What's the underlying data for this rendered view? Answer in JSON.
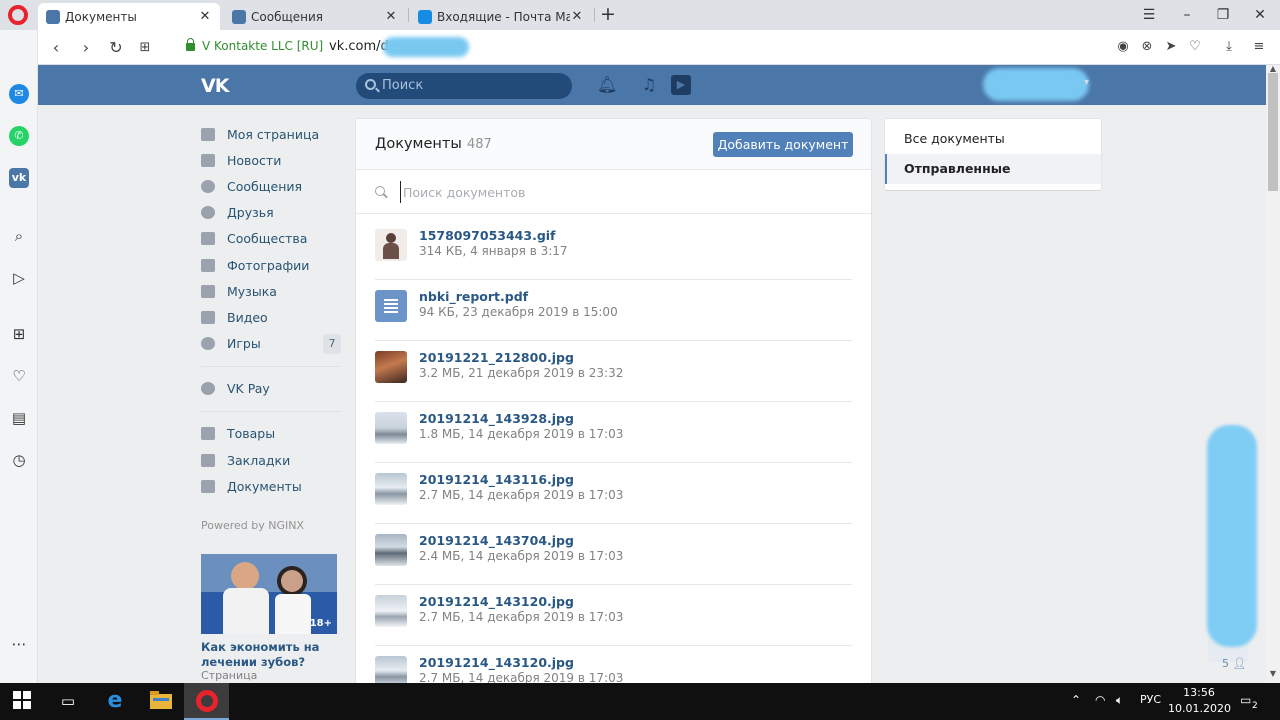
{
  "browser": {
    "tabs": [
      {
        "title": "Документы",
        "active": true
      },
      {
        "title": "Сообщения",
        "active": false
      },
      {
        "title": "Входящие - Почта Mail.ru",
        "active": false
      }
    ],
    "address": {
      "security_label": "V Kontakte LLC [RU]",
      "url": "vk.com/do"
    }
  },
  "vk": {
    "logo": "VK",
    "search_placeholder": "Поиск",
    "nav": [
      {
        "label": "Моя страница",
        "icon": "home-icon"
      },
      {
        "label": "Новости",
        "icon": "news-icon"
      },
      {
        "label": "Сообщения",
        "icon": "messages-icon"
      },
      {
        "label": "Друзья",
        "icon": "friends-icon"
      },
      {
        "label": "Сообщества",
        "icon": "groups-icon"
      },
      {
        "label": "Фотографии",
        "icon": "camera-icon"
      },
      {
        "label": "Музыка",
        "icon": "music-icon"
      },
      {
        "label": "Видео",
        "icon": "video-icon"
      },
      {
        "label": "Игры",
        "icon": "gamepad-icon",
        "badge": "7"
      }
    ],
    "nav_pay": {
      "label": "VK Pay",
      "icon": "vkpay-icon"
    },
    "nav_more": [
      {
        "label": "Товары",
        "icon": "bag-icon"
      },
      {
        "label": "Закладки",
        "icon": "star-icon"
      },
      {
        "label": "Документы",
        "icon": "document-icon"
      }
    ],
    "powered": "Powered by NGINX",
    "ad": {
      "age": "18+",
      "title": "Как экономить на лечении зубов?",
      "subtitle": "Страница"
    },
    "docs": {
      "title": "Документы",
      "count": "487",
      "add_button": "Добавить документ",
      "search_placeholder": "Поиск документов",
      "items": [
        {
          "name": "1578097053443.gif",
          "meta": "314 КБ, 4 января в 3:17",
          "thumb": "th-gif"
        },
        {
          "name": "nbki_report.pdf",
          "meta": "94 КБ, 23 декабря 2019 в 15:00",
          "thumb": "th-pdf"
        },
        {
          "name": "20191221_212800.jpg",
          "meta": "3.2 МБ, 21 декабря 2019 в 23:32",
          "thumb": "th-photo"
        },
        {
          "name": "20191214_143928.jpg",
          "meta": "1.8 МБ, 14 декабря 2019 в 17:03",
          "thumb": "th-snow1"
        },
        {
          "name": "20191214_143116.jpg",
          "meta": "2.7 МБ, 14 декабря 2019 в 17:03",
          "thumb": "th-snow2"
        },
        {
          "name": "20191214_143704.jpg",
          "meta": "2.4 МБ, 14 декабря 2019 в 17:03",
          "thumb": "th-snow3"
        },
        {
          "name": "20191214_143120.jpg",
          "meta": "2.7 МБ, 14 декабря 2019 в 17:03",
          "thumb": "th-snow4"
        },
        {
          "name": "20191214_143120.jpg",
          "meta": "2.7 МБ, 14 декабря 2019 в 17:03",
          "thumb": "th-snow2"
        }
      ]
    },
    "filter": {
      "all": "Все документы",
      "sent": "Отправленные"
    },
    "online_count": "5"
  },
  "taskbar": {
    "lang": "РУС",
    "time": "13:56",
    "date": "10.01.2020",
    "notifications": "2"
  }
}
